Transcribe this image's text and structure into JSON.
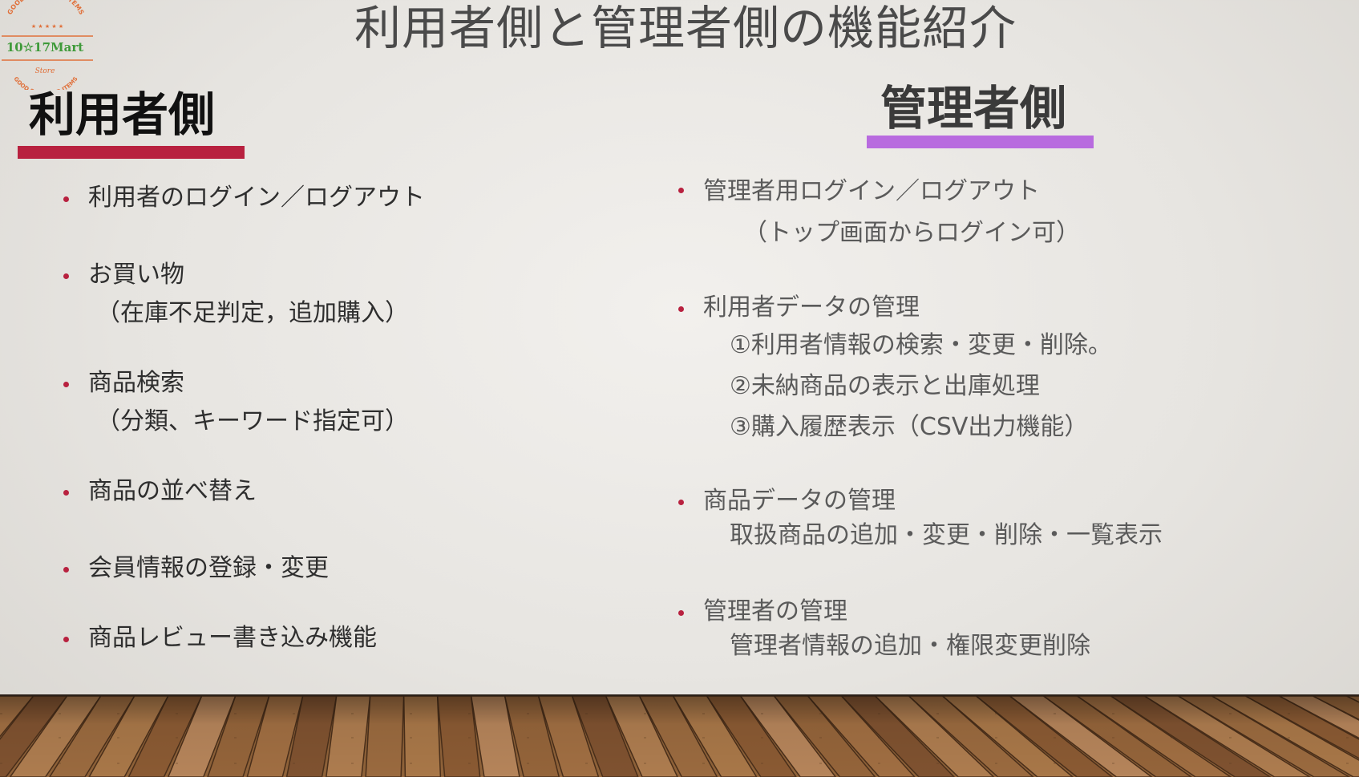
{
  "slide": {
    "title": "利用者側と管理者側の機能紹介",
    "logo": {
      "name": "10☆17Mart",
      "top_text": "GOOD SHOP AND ITEMS",
      "stars": "★ ★ ★ ★ ★",
      "sub_text": "Store",
      "bottom_text": "GOOD SHOP AND ITEMS",
      "colors": {
        "ring": "#e0703a",
        "name": "#3f9a3a"
      }
    },
    "left": {
      "heading": "利用者側",
      "accent": "#b8213f",
      "items": [
        {
          "lines": [
            "利用者のログイン／ログアウト"
          ]
        },
        {
          "lines": [
            "お買い物",
            "（在庫不足判定，追加購入）"
          ]
        },
        {
          "lines": [
            "商品検索",
            "（分類、キーワード指定可）"
          ]
        },
        {
          "lines": [
            "商品の並べ替え"
          ]
        },
        {
          "lines": [
            "会員情報の登録・変更"
          ]
        },
        {
          "lines": [
            "商品レビュー書き込み機能"
          ]
        }
      ]
    },
    "right": {
      "heading": "管理者側",
      "accent": "#b86bdf",
      "items": [
        {
          "lines": [
            "管理者用ログイン／ログアウト",
            "（トップ画面からログイン可）"
          ]
        },
        {
          "lines": [
            "利用者データの管理",
            "①利用者情報の検索・変更・削除。",
            "②未納商品の表示と出庫処理",
            "③購入履歴表示（CSV出力機能）"
          ]
        },
        {
          "lines": [
            "商品データの管理",
            "取扱商品の追加・変更・削除・一覧表示"
          ]
        },
        {
          "lines": [
            "管理者の管理",
            "管理者情報の追加・権限変更削除"
          ]
        }
      ]
    }
  }
}
